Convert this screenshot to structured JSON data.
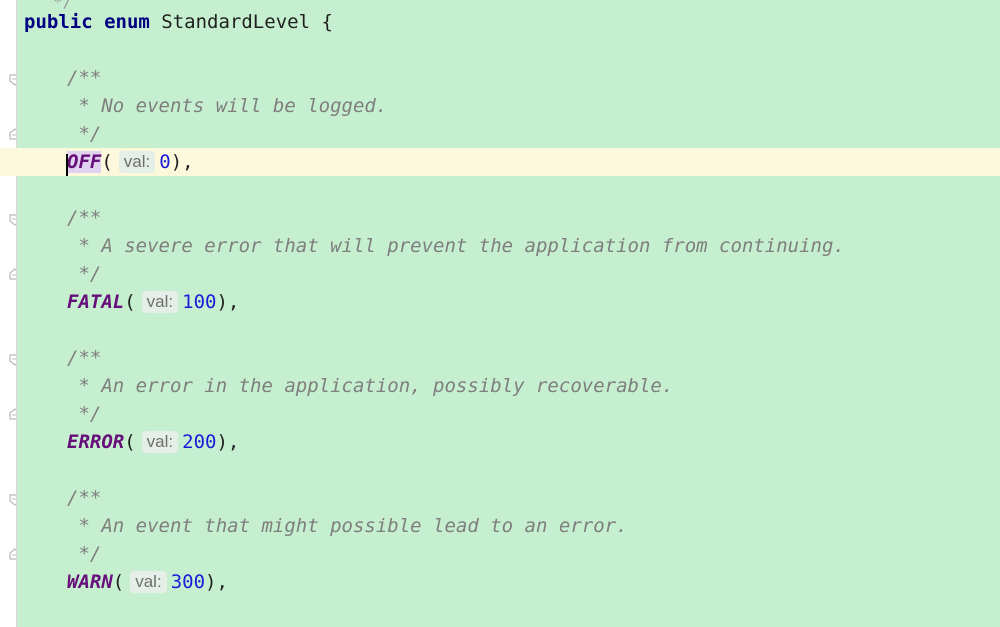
{
  "editor": {
    "top_stub": "*/",
    "lines": {
      "decl": {
        "public": "public",
        "enum": "enum",
        "rest": " StandardLevel {"
      },
      "c1_open": "/**",
      "c1_text": " * No events will be logged.",
      "c1_close": " */",
      "off": {
        "name_first": "O",
        "name_rest": "FF",
        "paren": "(",
        "hint": "val:",
        "value": "0",
        "tail": "),"
      },
      "c2_open": "/**",
      "c2_text": " * A severe error that will prevent the application from continuing.",
      "c2_close": " */",
      "fatal": {
        "name": "FATAL",
        "paren": "(",
        "hint": "val:",
        "value": "100",
        "tail": "),"
      },
      "c3_open": "/**",
      "c3_text": " * An error in the application, possibly recoverable.",
      "c3_close": " */",
      "error": {
        "name": "ERROR",
        "paren": "(",
        "hint": "val:",
        "value": "200",
        "tail": "),"
      },
      "c4_open": "/**",
      "c4_text": " * An event that might possible lead to an error.",
      "c4_close": " */",
      "warn": {
        "name": "WARN",
        "paren": "(",
        "hint": "val:",
        "value": "300",
        "tail": "),"
      }
    }
  },
  "colors": {
    "background": "#c6efd0",
    "current_line": "#fbf8dc",
    "keyword": "#000080",
    "comment": "#7e7e7e",
    "enum_constant": "#660e7a",
    "number": "#1c1cd8"
  },
  "icons": [
    "fold-marker-icon",
    "text-cursor-icon"
  ]
}
